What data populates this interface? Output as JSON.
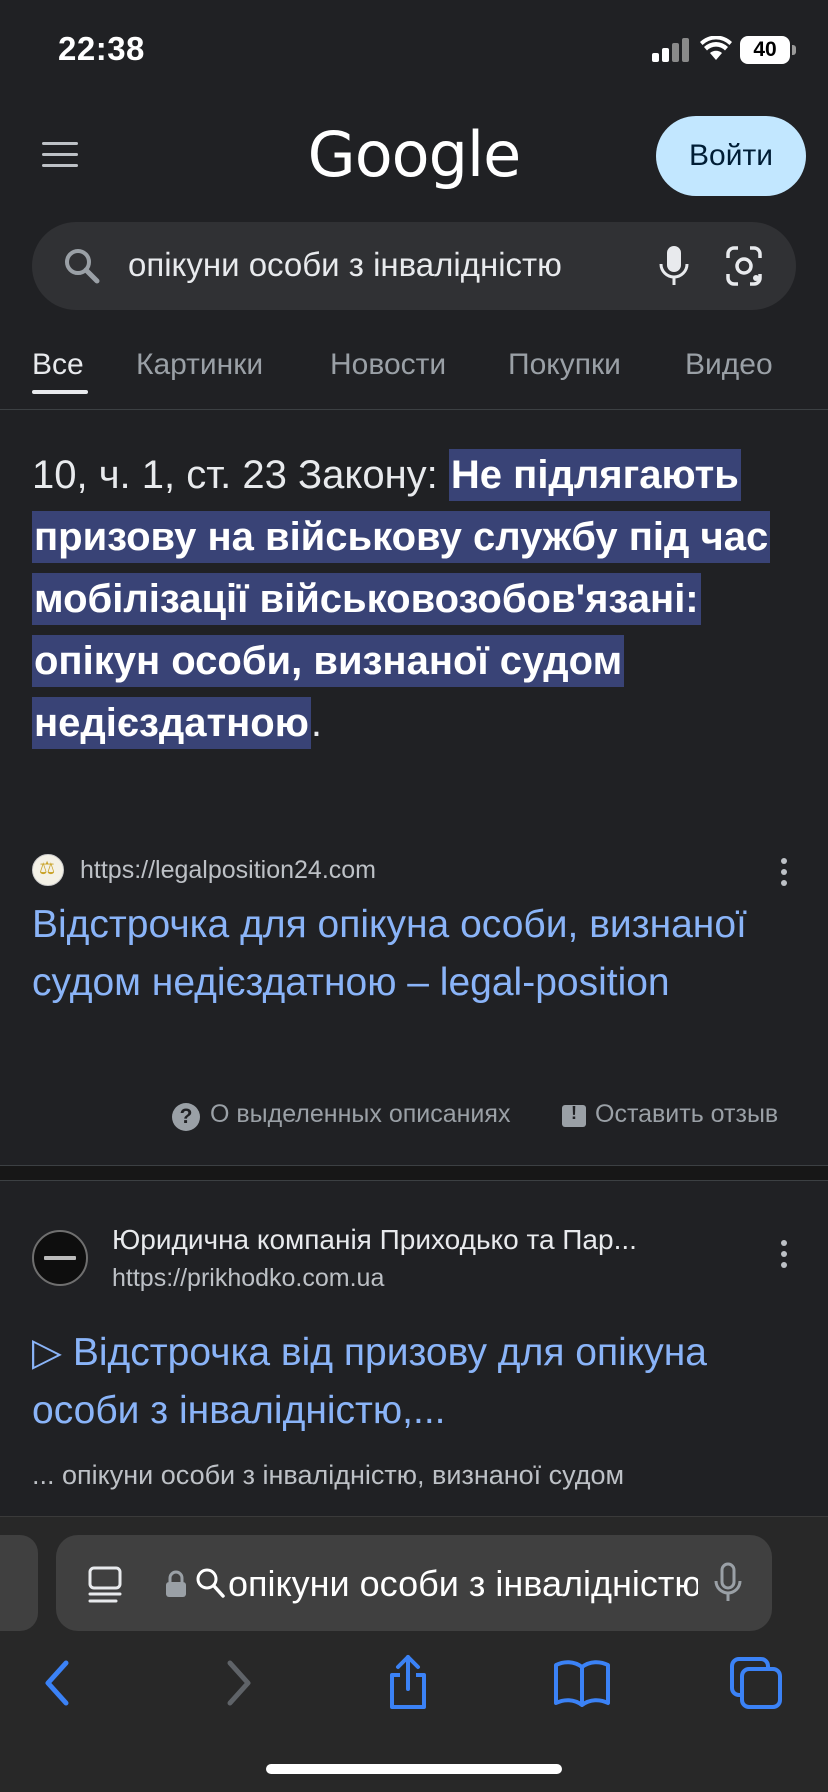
{
  "status_bar": {
    "time": "22:38",
    "battery": "40"
  },
  "header": {
    "logo": "Google",
    "signin_label": "Войти"
  },
  "search": {
    "query": "опікуни особи з інвалідністю"
  },
  "tabs": [
    "Все",
    "Картинки",
    "Новости",
    "Покупки",
    "Видео"
  ],
  "featured_snippet": {
    "prefix": "10, ч. 1, ст. 23 Закону: ",
    "highlight": "Не підлягають призову на військову службу під час мобілізації військовозобов'язані: опікун особи, визнаної судом недієздатною",
    "suffix": ".",
    "source_url": "https://legalposition24.com",
    "title": "Відстрочка для опікуна особи, визнаної судом недієздатною – legal-position",
    "about_label": "О выделенных описаниях",
    "feedback_label": "Оставить отзыв"
  },
  "result2": {
    "site_name": "Юридична компанія Приходько та Пар...",
    "url": "https://prikhodko.com.ua",
    "title": "▷ Відстрочка від призову для опікуна особи з інвалідністю,...",
    "snippet": "... опікуни особи з інвалідністю, визнаної судом"
  },
  "browser": {
    "address_text": "опікуни особи з інвалідністю",
    "accent_color": "#3b82f6"
  },
  "colors": {
    "background": "#202124",
    "link": "#8ab4f8",
    "highlight": "#394376",
    "signin_bg": "#c2e7ff"
  }
}
